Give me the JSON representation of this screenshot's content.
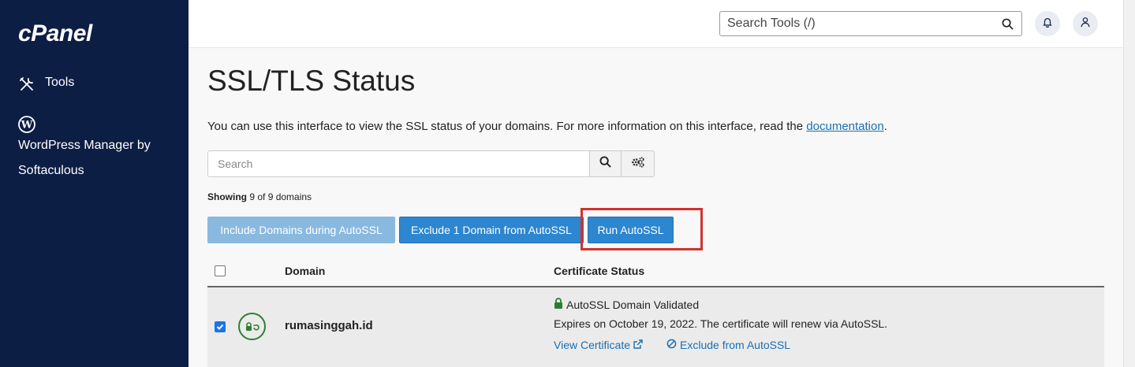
{
  "sidebar": {
    "logo": "cPanel",
    "items": [
      {
        "label": "Tools",
        "icon": "tools-icon"
      },
      {
        "label": "WordPress Manager by Softaculous",
        "icon": "wordpress-icon"
      }
    ]
  },
  "topbar": {
    "search_placeholder": "Search Tools (/)",
    "icons": [
      "search-icon",
      "bell-icon",
      "user-icon"
    ]
  },
  "main": {
    "title": "SSL/TLS Status",
    "intro_text": "You can use this interface to view the SSL status of your domains. For more information on this interface, read the ",
    "intro_link": "documentation",
    "intro_end": ".",
    "search_placeholder": "Search",
    "showing_label": "Showing",
    "showing_value": "9 of 9 domains",
    "buttons": {
      "include": "Include Domains during AutoSSL",
      "exclude": "Exclude 1 Domain from AutoSSL",
      "run": "Run AutoSSL"
    },
    "table": {
      "headers": {
        "domain": "Domain",
        "status": "Certificate Status"
      },
      "rows": [
        {
          "checked": true,
          "domain": "rumasinggah.id",
          "status_title": "AutoSSL Domain Validated",
          "expiry": "Expires on October 19, 2022. The certificate will renew via AutoSSL.",
          "view_link": "View Certificate",
          "exclude_link": "Exclude from AutoSSL"
        }
      ]
    }
  },
  "colors": {
    "sidebar_bg": "#0d1e45",
    "primary_button": "#2d86d0",
    "disabled_button": "#8ab9df",
    "highlight_border": "#d0312d",
    "valid_green": "#2e7d32",
    "link": "#1a6fb3"
  }
}
